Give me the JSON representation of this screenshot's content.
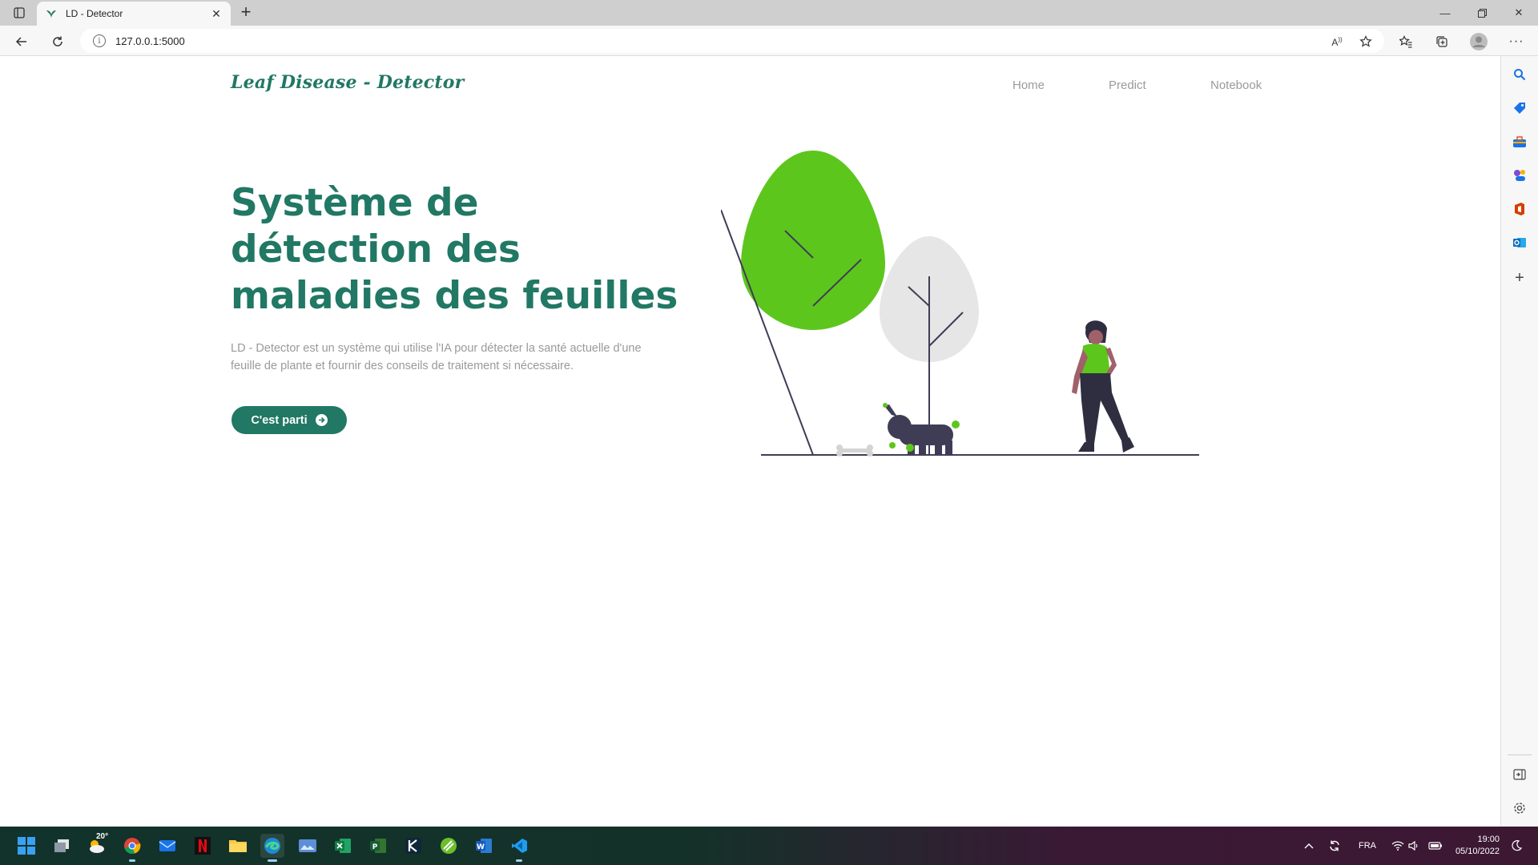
{
  "browser": {
    "tab_title": "LD - Detector",
    "url": "127.0.0.1:5000"
  },
  "site": {
    "brand": "Leaf Disease - Detector",
    "nav": [
      {
        "label": "Home"
      },
      {
        "label": "Predict"
      },
      {
        "label": "Notebook"
      }
    ],
    "hero": {
      "title": "Système de détection des maladies des feuilles",
      "description": "LD - Detector est un système qui utilise l'IA pour détecter la santé actuelle d'une feuille de plante et fournir des conseils de traitement si nécessaire.",
      "cta_label": "C'est parti"
    }
  },
  "colors": {
    "brand_green": "#217864",
    "tree_green": "#5dc61d",
    "tree_grey": "#e6e6e6",
    "dark": "#2f2e41"
  },
  "taskbar": {
    "weather_temp": "20°",
    "language": "FRA",
    "time": "19:00",
    "date": "05/10/2022",
    "apps": [
      "start-icon",
      "task-view-icon",
      "weather-icon",
      "chrome-icon",
      "mail-icon",
      "netflix-icon",
      "file-explorer-icon",
      "edge-icon",
      "photos-icon",
      "excel-icon",
      "project-icon",
      "kite-icon",
      "snap-icon",
      "word-icon",
      "vscode-icon"
    ]
  }
}
